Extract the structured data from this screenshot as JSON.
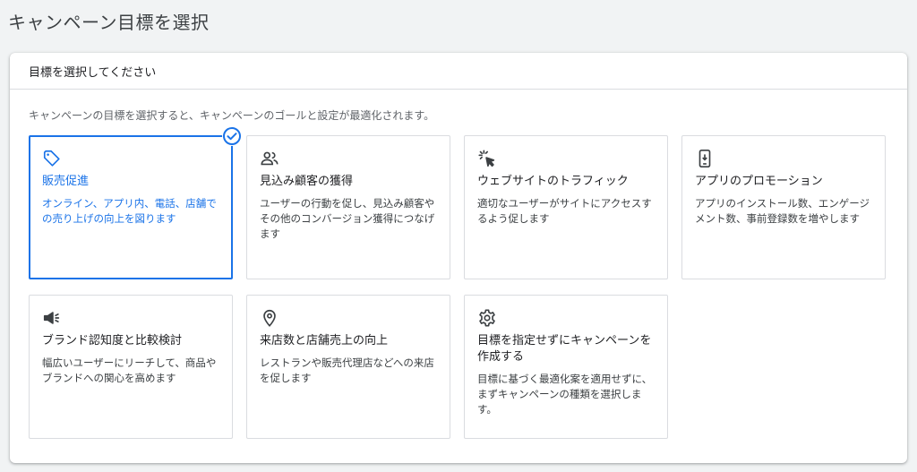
{
  "page": {
    "title": "キャンペーン目標を選択"
  },
  "panel": {
    "header": "目標を選択してください",
    "description": "キャンペーンの目標を選択すると、キャンペーンのゴールと設定が最適化されます。"
  },
  "cards": [
    {
      "icon": "tag-icon",
      "title": "販売促進",
      "description": "オンライン、アプリ内、電話、店舗での売り上げの向上を図ります",
      "selected": true
    },
    {
      "icon": "people-icon",
      "title": "見込み顧客の獲得",
      "description": "ユーザーの行動を促し、見込み顧客やその他のコンバージョン獲得につなげます",
      "selected": false
    },
    {
      "icon": "cursor-click-icon",
      "title": "ウェブサイトのトラフィック",
      "description": "適切なユーザーがサイトにアクセスするよう促します",
      "selected": false
    },
    {
      "icon": "phone-download-icon",
      "title": "アプリのプロモーション",
      "description": "アプリのインストール数、エンゲージメント数、事前登録数を増やします",
      "selected": false
    },
    {
      "icon": "megaphone-icon",
      "title": "ブランド認知度と比較検討",
      "description": "幅広いユーザーにリーチして、商品やブランドへの関心を高めます",
      "selected": false
    },
    {
      "icon": "location-pin-icon",
      "title": "来店数と店舗売上の向上",
      "description": "レストランや販売代理店などへの来店を促します",
      "selected": false
    },
    {
      "icon": "gear-icon",
      "title": "目標を指定せずにキャンペーンを作成する",
      "description": "目標に基づく最適化案を適用せずに、まずキャンペーンの種類を選択します。",
      "selected": false
    }
  ],
  "colors": {
    "accent": "#1a73e8",
    "border": "#dadce0",
    "icon": "#3c4043"
  }
}
